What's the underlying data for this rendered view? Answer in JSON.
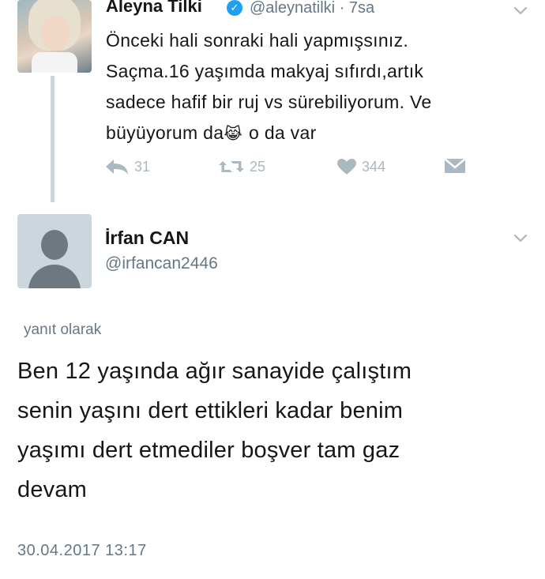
{
  "original_tweet": {
    "display_name": "Aleyna Tilki",
    "verified_icon": "verified-badge-icon",
    "handle": "@aleynatilki",
    "separator": "·",
    "time": "7sa",
    "text_line1": "Önceki hali sonraki hali yapmışsınız.",
    "text_line2": "Saçma.16 yaşımda makyaj sıfırdı,artık",
    "text_line3": "sadece hafif bir ruj vs sürebiliyorum. Ve",
    "text_line4a": "büyüyorum da",
    "emoji": "😹",
    "text_line4b": "o da var",
    "reply_count": "31",
    "retweet_count": "25",
    "like_count": "344"
  },
  "reply_tweet": {
    "display_name": "İrfan CAN",
    "handle": "@irfancan2446",
    "replying_label": "yanıt olarak",
    "text_line1": "Ben 12 yaşında ağır sanayide çalıştım",
    "text_line2": "senin yaşını dert ettikleri kadar benim",
    "text_line3": "yaşımı dert etmediler boşver tam gaz",
    "text_line4": "devam",
    "timestamp": "30.04.2017 13:17"
  },
  "icons": {
    "chevron": "chevron-down-icon",
    "reply": "reply-icon",
    "retweet": "retweet-icon",
    "like": "heart-icon",
    "dm": "envelope-icon"
  },
  "colors": {
    "text": "#14171a",
    "secondary": "#657786",
    "action_gray": "#aab8c2",
    "verified_blue": "#1da1f2",
    "thread_line": "#ccd6dd"
  }
}
